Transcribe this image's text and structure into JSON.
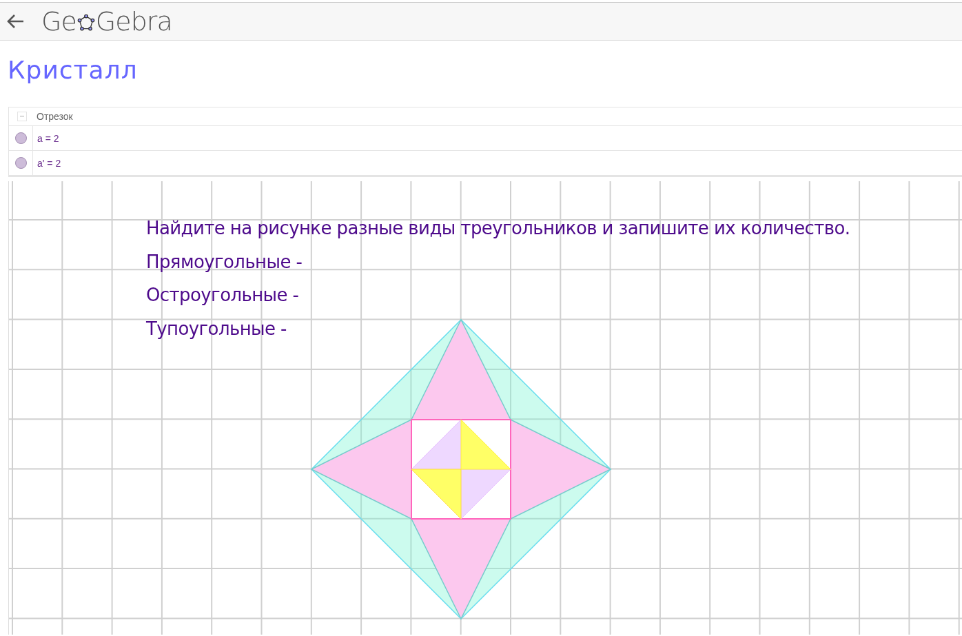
{
  "header": {
    "logo_start": "Ge",
    "logo_end": "Gebra"
  },
  "title": "Кристалл",
  "algebra": {
    "group": {
      "label": "Отрезок",
      "expanded": true
    },
    "items": [
      {
        "text": "a = 2",
        "visible": true
      },
      {
        "text": "a' = 2",
        "visible": true
      }
    ]
  },
  "graphics": {
    "texts": [
      "Найдите на рисунке разные виды треугольников и запишите их количество.",
      "Прямоугольные -",
      "Остроугольные -",
      "Тупоугольные -"
    ]
  }
}
